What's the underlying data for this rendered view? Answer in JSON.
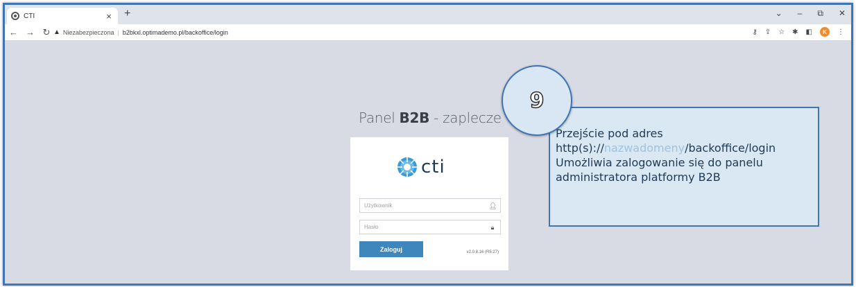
{
  "browser": {
    "tab_title": "CTI",
    "tab_close": "×",
    "new_tab": "+",
    "window_controls": [
      "⌄",
      "–",
      "⧉",
      "✕"
    ],
    "security_label": "Niezabezpieczona",
    "url": "b2bkxl.optimademo.pl/backoffice/login",
    "profile_initial": "K"
  },
  "page": {
    "title_prefix": "Panel ",
    "title_bold": "B2B",
    "title_suffix": " - zaplecze",
    "logo_text": "cti",
    "username_placeholder": "Użytkownik",
    "password_placeholder": "Hasło",
    "login_button": "Zaloguj",
    "version": "v2.0.8.16 (R5:27)"
  },
  "callout": {
    "step_number": "9",
    "line1": "Przejście pod adres",
    "line2_prefix": "http(s)://",
    "line2_highlight": "nazwadomeny",
    "line2_suffix": "/backoffice/login",
    "line3": "Umożliwia zalogowanie się do panelu",
    "line4": "administratora platformy B2B"
  },
  "colors": {
    "accent": "#3f75b4",
    "button": "#3d87bd",
    "page_bg": "#d8dbe4"
  }
}
